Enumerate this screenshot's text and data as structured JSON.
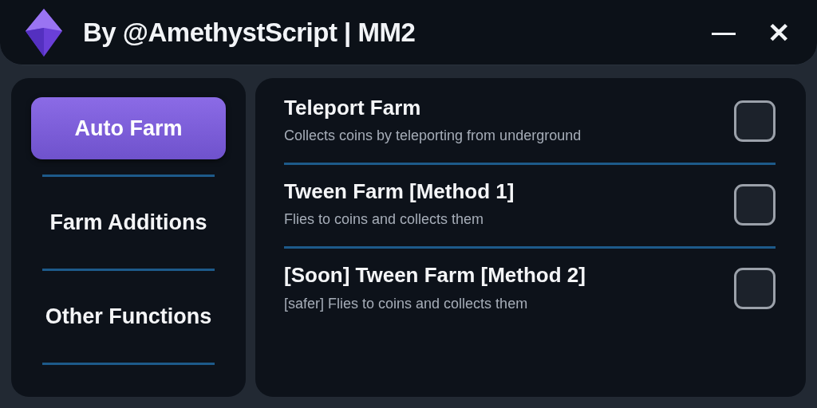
{
  "window": {
    "title": "By @AmethystScript | MM2",
    "controls": [
      {
        "kind": "minimize",
        "label": "—"
      },
      {
        "kind": "close",
        "label": "✕"
      }
    ]
  },
  "sidebar": {
    "items": [
      {
        "label": "Auto Farm",
        "selected": true
      },
      {
        "label": "Farm Additions",
        "selected": false
      },
      {
        "label": "Other Functions",
        "selected": false
      }
    ]
  },
  "options": [
    {
      "title": "Teleport Farm",
      "description": "Collects coins by teleporting from underground",
      "checked": false
    },
    {
      "title": "Tween Farm [Method 1]",
      "description": "Flies to coins and collects them",
      "checked": false
    },
    {
      "title": "[Soon] Tween Farm [Method 2]",
      "description": "[safer] Flies to coins and collects them",
      "checked": false
    }
  ]
}
